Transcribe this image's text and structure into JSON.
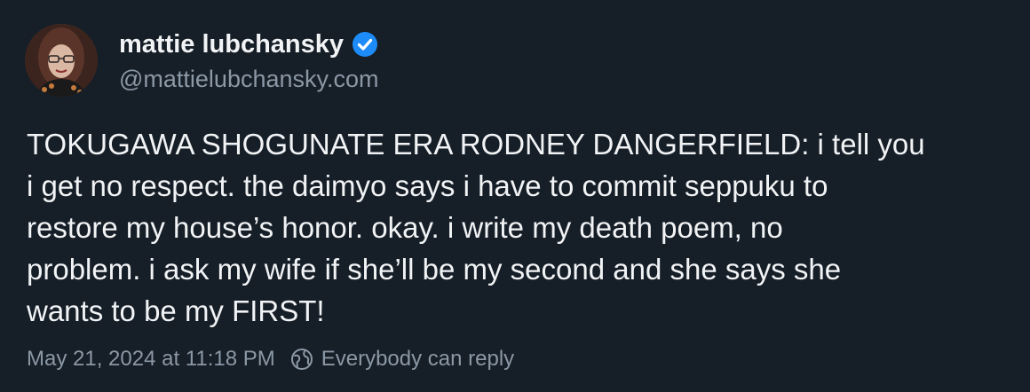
{
  "post": {
    "author": {
      "display_name": "mattie lubchansky",
      "handle": "@mattielubchansky.com",
      "verified": true,
      "verified_icon": "verified-check-icon"
    },
    "text": "TOKUGAWA SHOGUNATE ERA RODNEY DANGERFIELD: i tell you\ni get no respect. the daimyo says i have to commit seppuku to\nrestore my house’s honor. okay. i write my death poem, no\nproblem. i ask my wife if she’ll be my second and she says she\nwants to be my FIRST!",
    "timestamp": "May 21, 2024 at 11:18 PM",
    "reply_setting": {
      "icon": "globe-icon",
      "label": "Everybody can reply"
    }
  },
  "colors": {
    "background": "#161e27",
    "text": "#f1f3f5",
    "muted": "#8b98a5",
    "verified": "#1d8cf8"
  }
}
